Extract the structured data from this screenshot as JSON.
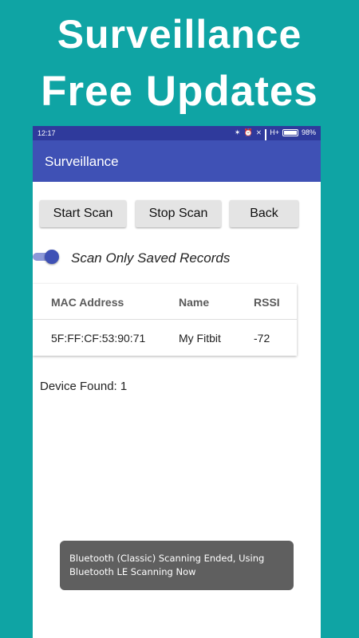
{
  "promo": {
    "line1": "Surveillance",
    "line2": "Free Updates"
  },
  "status_bar": {
    "time": "12:17",
    "network": "H+",
    "battery": "98%",
    "icons": [
      "bluetooth-icon",
      "alarm-icon",
      "no-signal-icon",
      "signal-icon",
      "battery-icon"
    ]
  },
  "app_bar": {
    "title": "Surveillance"
  },
  "buttons": {
    "start": "Start Scan",
    "stop": "Stop Scan",
    "back": "Back"
  },
  "toggle": {
    "label": "Scan Only Saved Records",
    "on": true
  },
  "table": {
    "headers": {
      "mac": "MAC Address",
      "name": "Name",
      "rssi": "RSSI"
    },
    "rows": [
      {
        "mac": "5F:FF:CF:53:90:71",
        "name": "My Fitbit",
        "rssi": "-72"
      }
    ]
  },
  "device_found": "Device Found: 1",
  "toast": {
    "line1": "Bluetooth (Classic) Scanning Ended, Using",
    "line2": "Bluetooth LE Scanning Now"
  },
  "colors": {
    "background": "#0fa4a4",
    "status_bar": "#2f3a9c",
    "app_bar": "#3f51b5",
    "accent": "#3f51b5",
    "toast": "#5f5f5f"
  }
}
